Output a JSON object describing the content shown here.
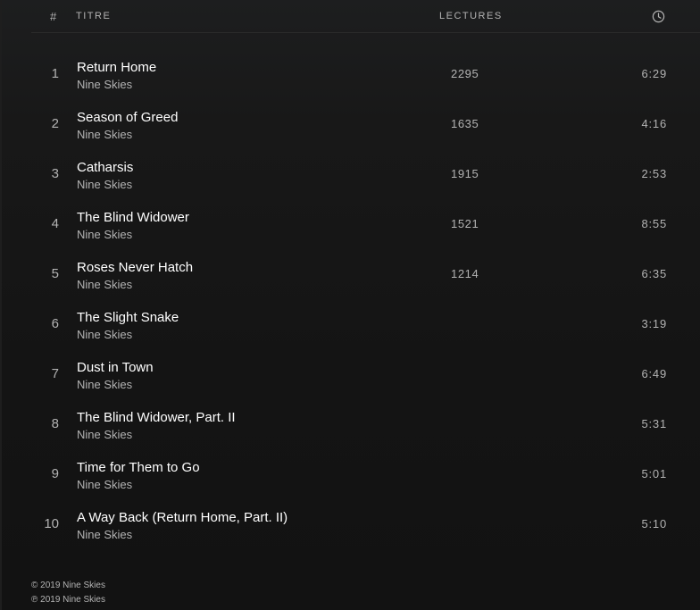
{
  "header": {
    "number_label": "#",
    "title_label": "TITRE",
    "plays_label": "LECTURES",
    "duration_icon": "clock-icon"
  },
  "tracks": [
    {
      "number": "1",
      "name": "Return Home",
      "artist": "Nine Skies",
      "plays": "2295",
      "duration": "6:29"
    },
    {
      "number": "2",
      "name": "Season of Greed",
      "artist": "Nine Skies",
      "plays": "1635",
      "duration": "4:16"
    },
    {
      "number": "3",
      "name": "Catharsis",
      "artist": "Nine Skies",
      "plays": "1915",
      "duration": "2:53"
    },
    {
      "number": "4",
      "name": "The Blind Widower",
      "artist": "Nine Skies",
      "plays": "1521",
      "duration": "8:55"
    },
    {
      "number": "5",
      "name": "Roses Never Hatch",
      "artist": "Nine Skies",
      "plays": "1214",
      "duration": "6:35"
    },
    {
      "number": "6",
      "name": "The Slight Snake",
      "artist": "Nine Skies",
      "plays": "",
      "duration": "3:19"
    },
    {
      "number": "7",
      "name": "Dust in Town",
      "artist": "Nine Skies",
      "plays": "",
      "duration": "6:49"
    },
    {
      "number": "8",
      "name": "The Blind Widower, Part. II",
      "artist": "Nine Skies",
      "plays": "",
      "duration": "5:31"
    },
    {
      "number": "9",
      "name": "Time for Them to Go",
      "artist": "Nine Skies",
      "plays": "",
      "duration": "5:01"
    },
    {
      "number": "10",
      "name": "A Way Back (Return Home, Part. II)",
      "artist": "Nine Skies",
      "plays": "",
      "duration": "5:10"
    }
  ],
  "footer": {
    "copyright": "© 2019 Nine Skies",
    "phonographic": "℗ 2019 Nine Skies"
  },
  "colors": {
    "background": "#121212",
    "text_primary": "#ffffff",
    "text_secondary": "#b3b3b3",
    "divider": "#2b2b2b"
  }
}
